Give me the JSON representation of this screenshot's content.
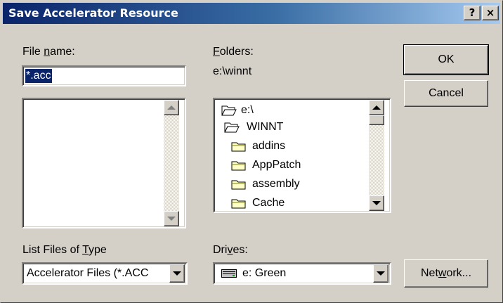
{
  "window": {
    "title": "Save Accelerator Resource",
    "help_button": "?",
    "close_button": "×"
  },
  "file_name": {
    "label": "File name:",
    "value": "*.acc",
    "files": []
  },
  "folders": {
    "label": "Folders:",
    "current_path": "e:\\winnt",
    "items": [
      {
        "name": "e:\\",
        "icon": "open-folder-icon"
      },
      {
        "name": "WINNT",
        "icon": "open-folder-icon"
      },
      {
        "name": "addins",
        "icon": "folder-icon"
      },
      {
        "name": "AppPatch",
        "icon": "folder-icon"
      },
      {
        "name": "assembly",
        "icon": "folder-icon"
      },
      {
        "name": "Cache",
        "icon": "folder-icon"
      }
    ]
  },
  "file_type": {
    "label": "List Files of Type",
    "value": "Accelerator Files (*.ACC"
  },
  "drives": {
    "label": "Drives:",
    "value": "e: Green",
    "icon": "drive-icon"
  },
  "buttons": {
    "ok": "OK",
    "cancel": "Cancel",
    "network": "Network..."
  },
  "colors": {
    "title_start": "#0a246a",
    "title_end": "#a6caf0",
    "face": "#d4d0c8",
    "selection": "#0a246a"
  }
}
